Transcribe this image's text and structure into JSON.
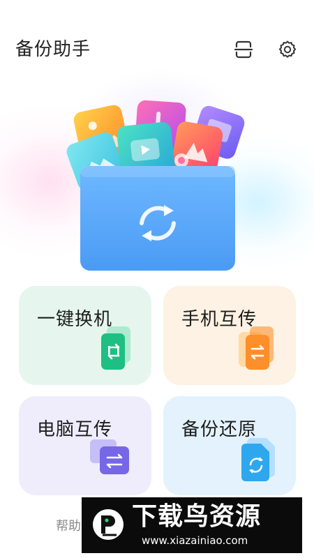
{
  "header": {
    "title": "备份助手",
    "scan_icon": "scan-icon",
    "settings_icon": "gear-icon"
  },
  "hero": {
    "illustration": "folder-with-media-sync-illustration"
  },
  "cards": {
    "one_key_transfer": {
      "label": "一键换机",
      "icon": "phone-transfer-icon",
      "color": "#1dbf83"
    },
    "phone_transfer": {
      "label": "手机互传",
      "icon": "phone-exchange-icon",
      "color": "#ff8a1f"
    },
    "pc_transfer": {
      "label": "电脑互传",
      "icon": "pc-exchange-icon",
      "color": "#7667e6"
    },
    "backup_restore": {
      "label": "备份还原",
      "icon": "backup-restore-icon",
      "color": "#2ea7ee"
    }
  },
  "footer": {
    "help_text": "帮助"
  },
  "watermark": {
    "brand": "下载鸟资源",
    "url": "www.xiazainiao.com"
  }
}
